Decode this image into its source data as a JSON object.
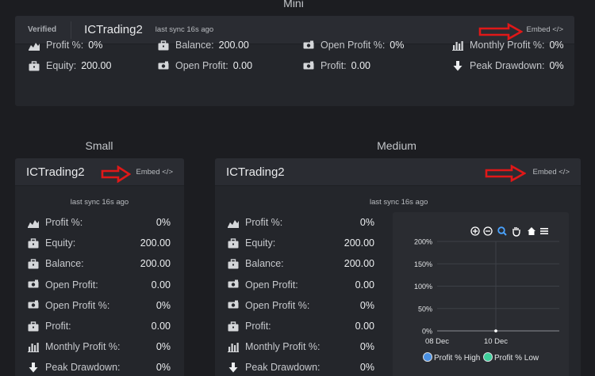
{
  "sections": {
    "mini": "Mini",
    "small": "Small",
    "medium": "Medium"
  },
  "mini": {
    "verified": "Verified",
    "title": "ICTrading2",
    "sync": "last sync 16s ago",
    "embed": "Embed </>",
    "stats": [
      {
        "label": "Profit %:",
        "value": "0%",
        "icon": "mountain-chart-icon"
      },
      {
        "label": "Balance:",
        "value": "200.00",
        "icon": "briefcase-icon"
      },
      {
        "label": "Open Profit %:",
        "value": "0%",
        "icon": "money-bill-icon"
      },
      {
        "label": "Monthly Profit %:",
        "value": "0%",
        "icon": "bar-chart-icon"
      },
      {
        "label": "Equity:",
        "value": "200.00",
        "icon": "briefcase-icon"
      },
      {
        "label": "Open Profit:",
        "value": "0.00",
        "icon": "money-bill-icon"
      },
      {
        "label": "Profit:",
        "value": "0.00",
        "icon": "money-bill-icon"
      },
      {
        "label": "Peak Drawdown:",
        "value": "0%",
        "icon": "arrow-down-icon"
      }
    ]
  },
  "small": {
    "title": "ICTrading2",
    "embed": "Embed </>",
    "sync": "last sync 16s ago",
    "rows": [
      {
        "label": "Profit %:",
        "value": "0%",
        "icon": "mountain-chart-icon"
      },
      {
        "label": "Equity:",
        "value": "200.00",
        "icon": "briefcase-icon"
      },
      {
        "label": "Balance:",
        "value": "200.00",
        "icon": "briefcase-icon"
      },
      {
        "label": "Open Profit:",
        "value": "0.00",
        "icon": "money-bill-icon"
      },
      {
        "label": "Open Profit %:",
        "value": "0%",
        "icon": "money-bill-icon"
      },
      {
        "label": "Profit:",
        "value": "0.00",
        "icon": "briefcase-icon"
      },
      {
        "label": "Monthly Profit %:",
        "value": "0%",
        "icon": "bar-chart-icon"
      },
      {
        "label": "Peak Drawdown:",
        "value": "0%",
        "icon": "arrow-down-icon"
      }
    ]
  },
  "medium": {
    "title": "ICTrading2",
    "embed": "Embed </>",
    "sync": "last sync 16s ago",
    "rows": [
      {
        "label": "Profit %:",
        "value": "0%",
        "icon": "mountain-chart-icon"
      },
      {
        "label": "Equity:",
        "value": "200.00",
        "icon": "briefcase-icon"
      },
      {
        "label": "Balance:",
        "value": "200.00",
        "icon": "briefcase-icon"
      },
      {
        "label": "Open Profit:",
        "value": "0.00",
        "icon": "money-bill-icon"
      },
      {
        "label": "Open Profit %:",
        "value": "0%",
        "icon": "money-bill-icon"
      },
      {
        "label": "Profit:",
        "value": "0.00",
        "icon": "briefcase-icon"
      },
      {
        "label": "Monthly Profit %:",
        "value": "0%",
        "icon": "bar-chart-icon"
      },
      {
        "label": "Peak Drawdown:",
        "value": "0%",
        "icon": "arrow-down-icon"
      }
    ]
  },
  "colors": {
    "arrow": "#e01818",
    "series_high": "#4a90e2",
    "series_low": "#3ecf9a"
  },
  "chart_data": {
    "type": "line",
    "x": [
      "08 Dec",
      "10 Dec"
    ],
    "xticks": [
      "08 Dec",
      "10 Dec"
    ],
    "yticks": [
      "200%",
      "150%",
      "100%",
      "50%",
      "0%"
    ],
    "ylim": [
      0,
      200
    ],
    "series": [
      {
        "name": "Profit % High",
        "values": [
          0,
          0
        ]
      },
      {
        "name": "Profit % Low",
        "values": [
          0,
          0
        ]
      }
    ],
    "toolbar": [
      "zoom-in-icon",
      "zoom-out-icon",
      "magnify-icon",
      "pan-hand-icon",
      "home-icon",
      "menu-icon"
    ],
    "legend_position": "bottom"
  }
}
